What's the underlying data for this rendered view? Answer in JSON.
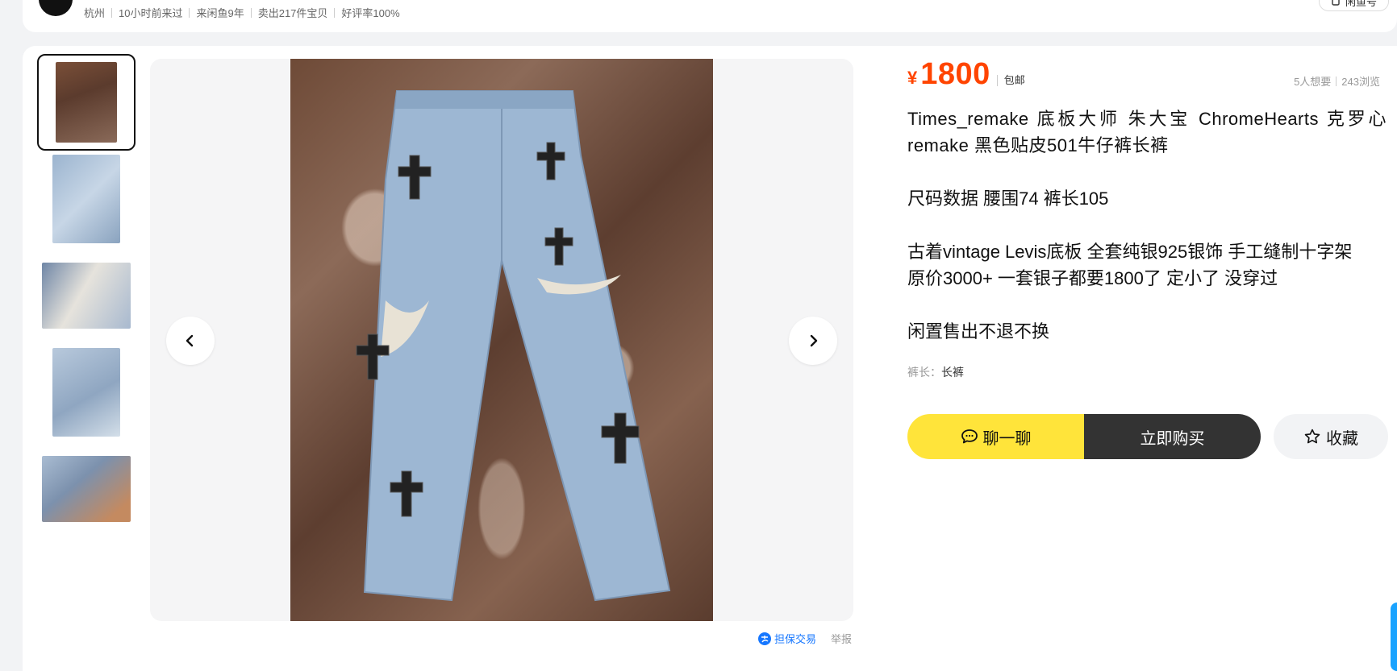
{
  "seller": {
    "location": "杭州",
    "last_seen": "10小时前来过",
    "member_since": "来闲鱼9年",
    "sold": "卖出217件宝贝",
    "rating": "好评率100%",
    "top_right_button": "闲鱼号"
  },
  "gallery": {
    "thumbnails": [
      "jeans-front",
      "jeans-patch-closeup",
      "jeans-waist-closeup",
      "jeans-full",
      "jeans-label-closeup"
    ],
    "active_index": 0
  },
  "product": {
    "currency": "¥",
    "price": "1800",
    "shipping": "包邮",
    "wants": "5人想要",
    "views": "243浏览",
    "title": "Times_remake 底板大师 朱大宝 ChromeHearts 克罗心 remake 黑色贴皮501牛仔裤长裤",
    "size_info": "尺码数据 腰围74 裤长105",
    "detail_line1": "古着vintage Levis底板 全套纯银925银饰 手工缝制十字架",
    "detail_line2": "原价3000+ 一套银子都要1800了 定小了 没穿过",
    "policy": "闲置售出不退不换",
    "attr_key": "裤长：",
    "attr_value": "长裤"
  },
  "actions": {
    "chat": "聊一聊",
    "buy": "立即购买",
    "favorite": "收藏"
  },
  "footer": {
    "guarantee": "担保交易",
    "report": "举报"
  },
  "colors": {
    "price": "#ff4400",
    "chat_button": "#ffe43a",
    "buy_button": "#333333",
    "guarantee": "#1677ff"
  }
}
